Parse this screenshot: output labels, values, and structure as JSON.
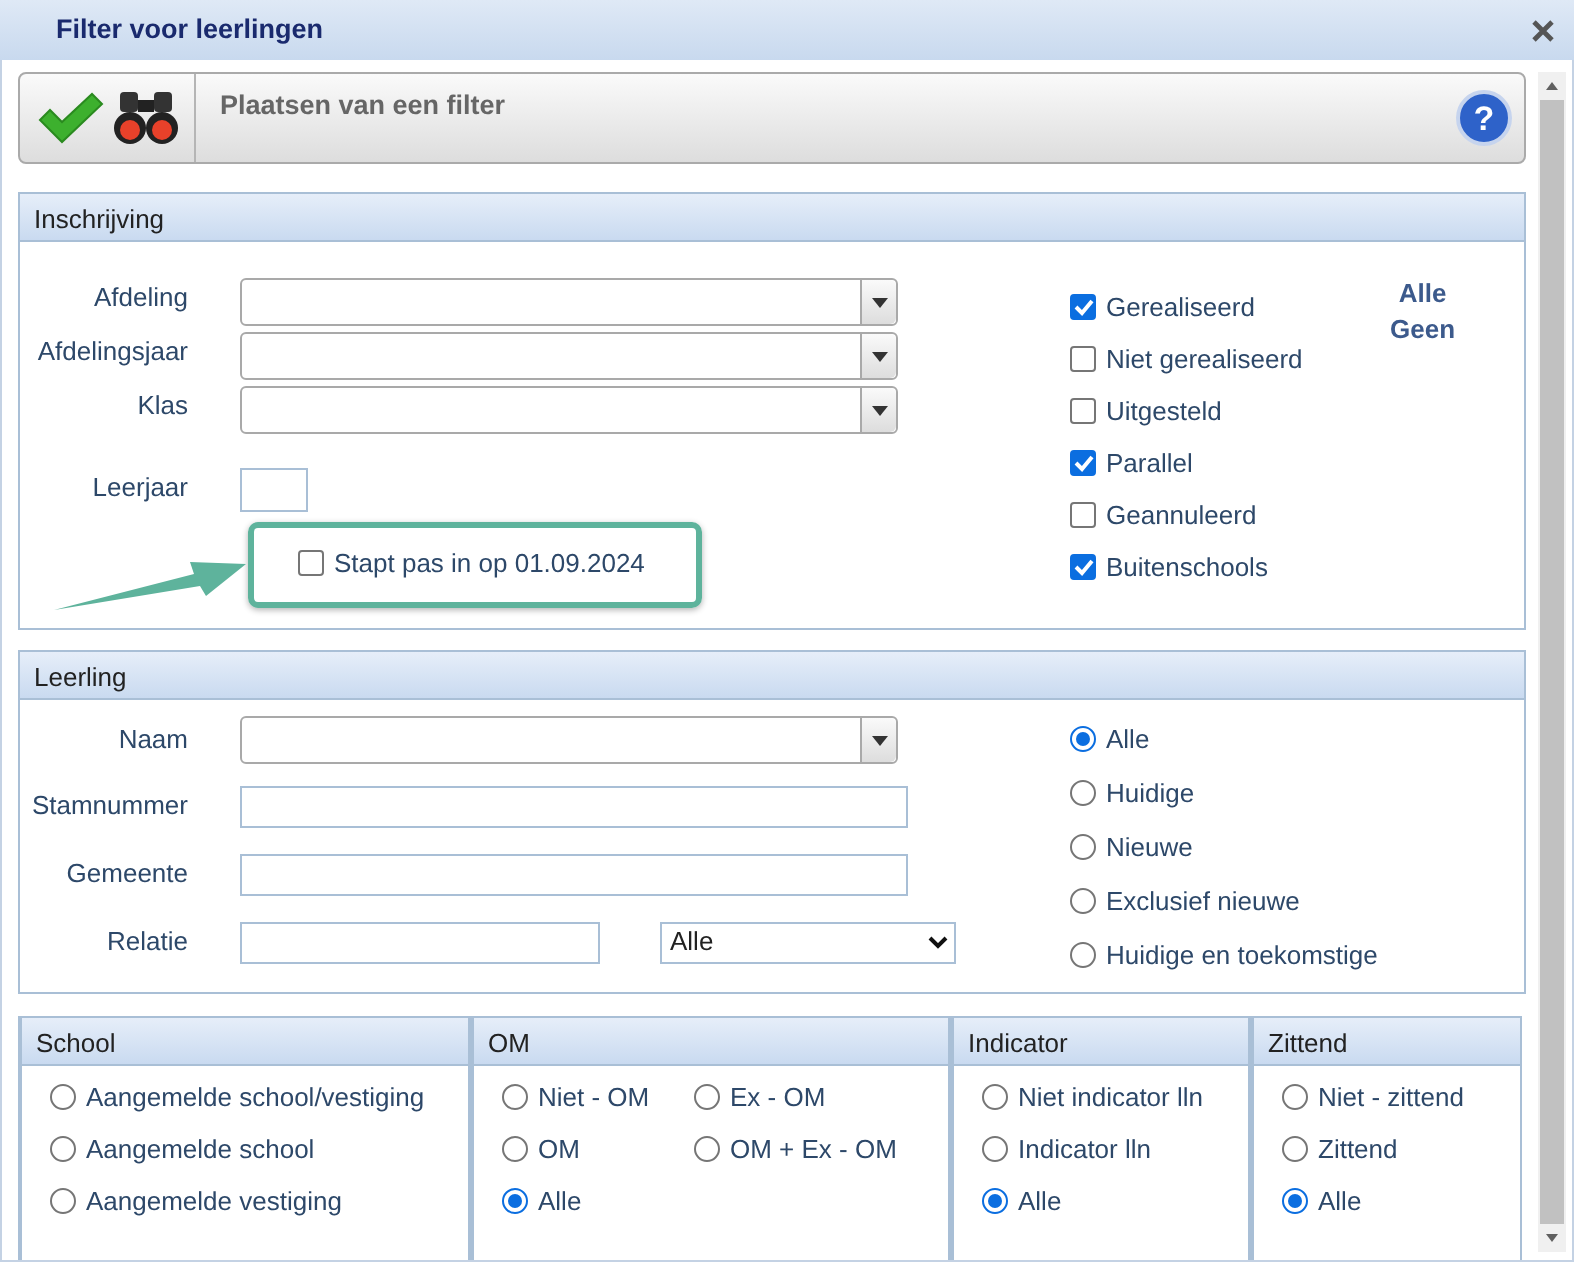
{
  "window": {
    "title": "Filter voor leerlingen"
  },
  "toolbar": {
    "title": "Plaatsen van een filter",
    "help": "?"
  },
  "inschrijving": {
    "title": "Inschrijving",
    "fields": [
      {
        "kind": "combo",
        "label": "Afdeling"
      },
      {
        "kind": "combo",
        "label": "Afdelingsjaar"
      },
      {
        "kind": "combo",
        "label": "Klas"
      },
      {
        "kind": "small",
        "label": "Leerjaar"
      }
    ],
    "starts_later": {
      "label": "Stapt pas in op 01.09.2024",
      "checked": false,
      "highlighted": true
    },
    "statuses": [
      {
        "label": "Gerealiseerd",
        "checked": true
      },
      {
        "label": "Niet gerealiseerd",
        "checked": false
      },
      {
        "label": "Uitgesteld",
        "checked": false
      },
      {
        "label": "Parallel",
        "checked": true
      },
      {
        "label": "Geannuleerd",
        "checked": false
      },
      {
        "label": "Buitenschools",
        "checked": true
      }
    ],
    "links": [
      "Alle",
      "Geen"
    ]
  },
  "leerling": {
    "title": "Leerling",
    "fields": [
      {
        "kind": "combo",
        "label": "Naam"
      },
      {
        "kind": "text",
        "label": "Stamnummer"
      },
      {
        "kind": "text",
        "label": "Gemeente"
      },
      {
        "kind": "text-select",
        "label": "Relatie",
        "select_value": "Alle"
      }
    ],
    "scope": [
      {
        "label": "Alle",
        "selected": true
      },
      {
        "label": "Huidige",
        "selected": false
      },
      {
        "label": "Nieuwe",
        "selected": false
      },
      {
        "label": "Exclusief nieuwe",
        "selected": false
      },
      {
        "label": "Huidige en toekomstige",
        "selected": false
      }
    ]
  },
  "panels": [
    {
      "title": "School",
      "kind": "one-column",
      "options": [
        {
          "label": "Aangemelde school/vestiging",
          "selected": false
        },
        {
          "label": "Aangemelde school",
          "selected": false
        },
        {
          "label": "Aangemelde vestiging",
          "selected": false
        }
      ]
    },
    {
      "title": "OM",
      "kind": "two-column",
      "options": [
        {
          "label": "Niet - OM",
          "selected": false
        },
        {
          "label": "Ex - OM",
          "selected": false
        },
        {
          "label": "OM",
          "selected": false
        },
        {
          "label": "OM + Ex - OM",
          "selected": false
        },
        {
          "label": "Alle",
          "selected": true
        }
      ]
    },
    {
      "title": "Indicator",
      "kind": "one-column",
      "options": [
        {
          "label": "Niet indicator lln",
          "selected": false
        },
        {
          "label": "Indicator lln",
          "selected": false
        },
        {
          "label": "Alle",
          "selected": true
        }
      ]
    },
    {
      "title": "Zittend",
      "kind": "one-column",
      "options": [
        {
          "label": "Niet - zittend",
          "selected": false
        },
        {
          "label": "Zittend",
          "selected": false
        },
        {
          "label": "Alle",
          "selected": true
        }
      ]
    }
  ]
}
